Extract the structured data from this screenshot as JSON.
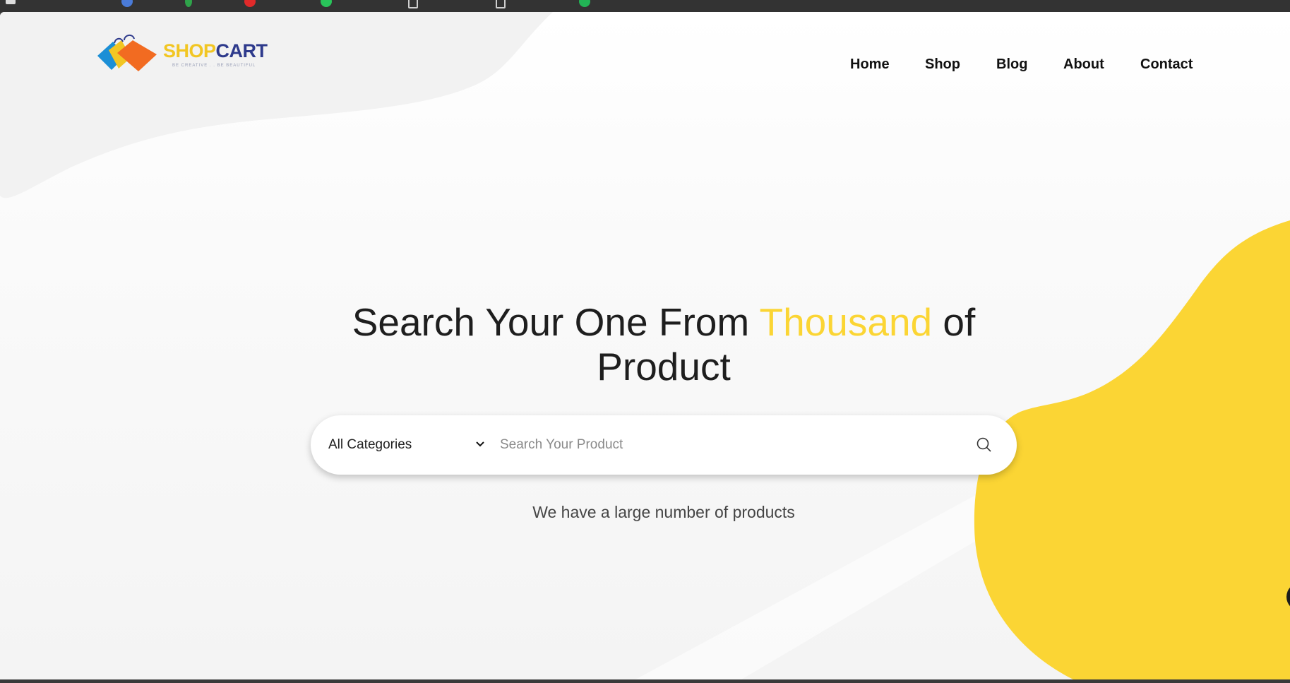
{
  "brand": {
    "name_part1": "SHOP",
    "name_part2": "CART",
    "tagline": "BE CREATIVE . . BE BEAUTIFUL"
  },
  "nav": {
    "items": [
      {
        "label": "Home"
      },
      {
        "label": "Shop"
      },
      {
        "label": "Blog"
      },
      {
        "label": "About"
      },
      {
        "label": "Contact"
      }
    ]
  },
  "hero": {
    "title_before": "Search Your One From ",
    "title_highlight": "Thousand",
    "title_after": " of Product",
    "subtitle": "We have a large number of products"
  },
  "search": {
    "category_selected": "All Categories",
    "placeholder": "Search Your Product",
    "value": ""
  },
  "icons": {
    "category_dropdown": "chevron-down-icon",
    "search": "search-icon",
    "chat": "chat-icon"
  },
  "colors": {
    "accent_yellow": "#fbd534",
    "brand_blue": "#2e3a8c",
    "brand_yellow": "#f2c623",
    "text_dark": "#111111",
    "blob_gray": "#f2f2f2"
  }
}
